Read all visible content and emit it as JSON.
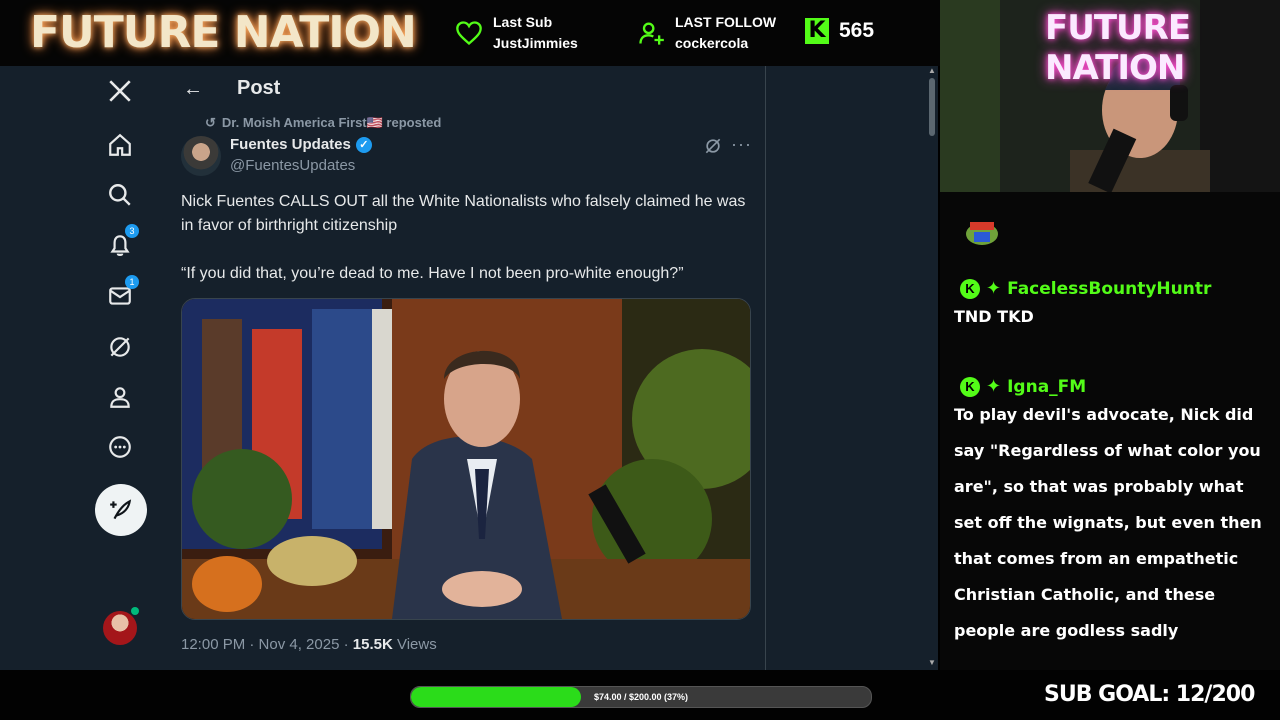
{
  "overlay": {
    "logo": "FUTURE NATION",
    "last_sub_label": "Last Sub",
    "last_sub_name": "JustJimmies",
    "last_follow_label": "LAST FOLLOW",
    "last_follow_name": "cockercola",
    "kick_count": "565",
    "cam_sign": "FUTURE NATION",
    "progress": {
      "text": "$74.00 / $200.00 (37%)",
      "fraction": 0.37
    },
    "sub_goal": "SUB GOAL: 12/200",
    "colors": {
      "accent": "#53fc18",
      "progress": "#2bdc1a"
    }
  },
  "x": {
    "nav": [
      {
        "icon": "x-logo-icon"
      },
      {
        "icon": "home-icon"
      },
      {
        "icon": "search-icon"
      },
      {
        "icon": "bell-icon",
        "badge": "3"
      },
      {
        "icon": "mail-icon",
        "badge": "1"
      },
      {
        "icon": "grok-icon"
      },
      {
        "icon": "profile-icon"
      },
      {
        "icon": "more-icon"
      }
    ],
    "header_title": "Post",
    "repost_by": "Dr. Moish America First🇺🇸 reposted",
    "author_name": "Fuentes Updates",
    "author_handle": "@FuentesUpdates",
    "text_1": "Nick Fuentes CALLS OUT all the White Nationalists who falsely claimed he was in favor of birthright citizenship",
    "text_2": "“If you did that, you’re dead to me. Have I not been pro-white enough?”",
    "time": "12:00 PM · Nov 4, 2025 · ",
    "views_count": "15.5K",
    "views_label": " Views"
  },
  "chat": {
    "messages": [
      {
        "user": "FacelessBountyHuntr",
        "text": "TND TKD"
      },
      {
        "user": "Igna_FM",
        "text": "To play devil's advocate, Nick did say \"Regardless of what color you are\", so that was probably what set off the wignats, but even then that comes from an empathetic Christian Catholic, and these people are godless sadly"
      }
    ]
  }
}
